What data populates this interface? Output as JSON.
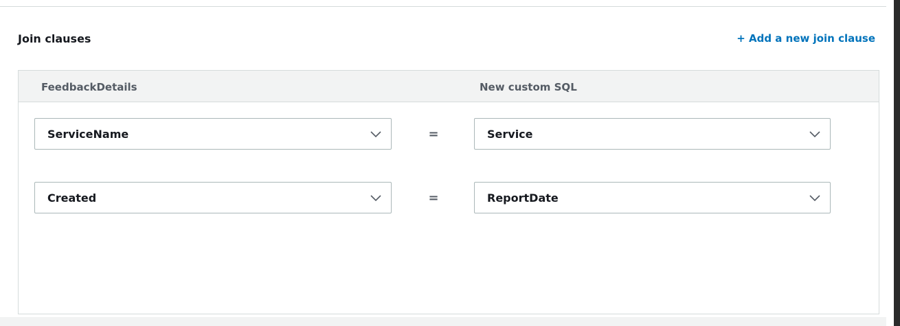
{
  "section": {
    "title": "Join clauses",
    "add_link": "+ Add a new join clause"
  },
  "table": {
    "left_header": "FeedbackDetails",
    "right_header": "New custom SQL",
    "operator": "=",
    "rows": [
      {
        "left": "ServiceName",
        "right": "Service"
      },
      {
        "left": "Created",
        "right": "ReportDate"
      }
    ]
  },
  "icons": {
    "dropdown": "chevron-down-icon"
  },
  "colors": {
    "link": "#0073bb",
    "header_bg": "#f2f3f3",
    "border": "#aab7b8"
  }
}
